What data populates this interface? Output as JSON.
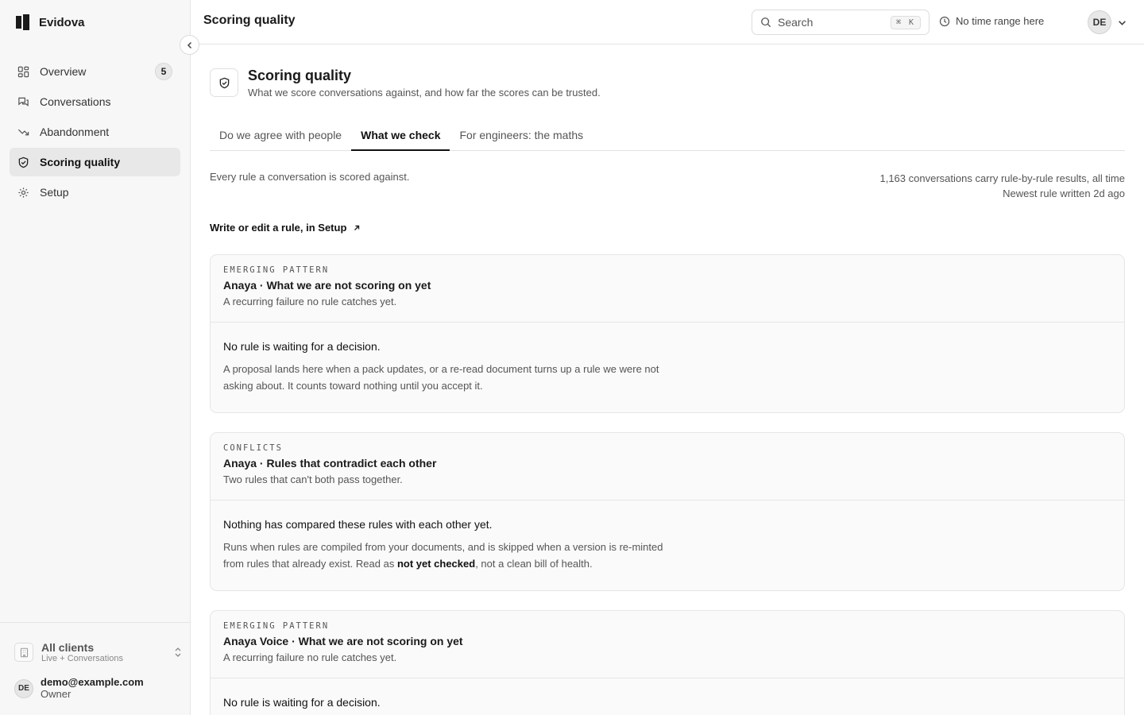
{
  "brand": {
    "name": "Evidova"
  },
  "sidebar": {
    "items": [
      {
        "label": "Overview",
        "badge": "5"
      },
      {
        "label": "Conversations"
      },
      {
        "label": "Abandonment"
      },
      {
        "label": "Scoring quality"
      },
      {
        "label": "Setup"
      }
    ],
    "clients": {
      "title": "All clients",
      "subtitle": "Live + Conversations"
    },
    "user": {
      "initials": "DE",
      "email": "demo@example.com",
      "role": "Owner"
    }
  },
  "header": {
    "title": "Scoring quality",
    "search_placeholder": "Search",
    "search_shortcut": "⌘ K",
    "time_range": "No time range here",
    "user_initials": "DE"
  },
  "page": {
    "title": "Scoring quality",
    "subtitle": "What we score conversations against, and how far the scores can be trusted.",
    "tabs": [
      {
        "label": "Do we agree with people"
      },
      {
        "label": "What we check"
      },
      {
        "label": "For engineers: the maths"
      }
    ],
    "intro": "Every rule a conversation is scored against.",
    "meta_line1": "1,163 conversations carry rule-by-rule results, all time",
    "meta_line2": "Newest rule written 2d  ago",
    "setup_link": "Write or edit a rule, in Setup"
  },
  "cards": [
    {
      "kicker": "EMERGING PATTERN",
      "title": "Anaya · What we are not scoring on yet",
      "subtitle": "A recurring failure no rule catches yet.",
      "body_title": "No rule is waiting for a decision.",
      "body_text": "A proposal lands here when a pack updates, or a re-read document turns up a rule we were not asking about. It counts toward nothing until you accept it."
    },
    {
      "kicker": "CONFLICTS",
      "title": "Anaya · Rules that contradict each other",
      "subtitle": "Two rules that can't both pass together.",
      "body_title": "Nothing has compared these rules with each other yet.",
      "body_text_pre": "Runs when rules are compiled from your documents, and is skipped when a version is re-minted from rules that already exist. Read as ",
      "body_text_strong": "not yet checked",
      "body_text_post": ", not a clean bill of health."
    },
    {
      "kicker": "EMERGING PATTERN",
      "title": "Anaya Voice · What we are not scoring on yet",
      "subtitle": "A recurring failure no rule catches yet.",
      "body_title": "No rule is waiting for a decision."
    }
  ]
}
